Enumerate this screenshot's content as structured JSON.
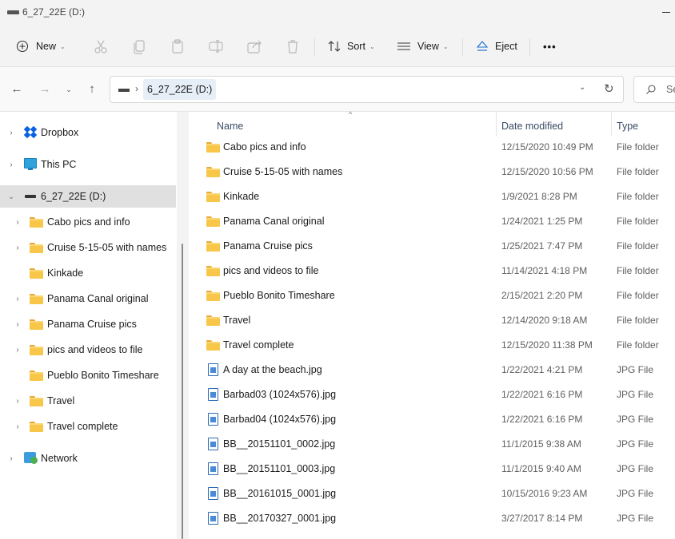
{
  "window": {
    "title": "6_27_22E (D:)"
  },
  "toolbar": {
    "new_label": "New",
    "sort_label": "Sort",
    "view_label": "View",
    "eject_label": "Eject",
    "more_label": "•••"
  },
  "address": {
    "crumb": "6_27_22E (D:)",
    "search_placeholder": "Se"
  },
  "nav": {
    "items": [
      {
        "label": "Dropbox"
      },
      {
        "label": "This PC"
      },
      {
        "label": "6_27_22E (D:)"
      },
      {
        "label": "Cabo pics and info"
      },
      {
        "label": "Cruise 5-15-05 with names"
      },
      {
        "label": "Kinkade"
      },
      {
        "label": "Panama Canal original"
      },
      {
        "label": "Panama Cruise pics"
      },
      {
        "label": "pics and videos to file"
      },
      {
        "label": "Pueblo Bonito Timeshare"
      },
      {
        "label": "Travel"
      },
      {
        "label": "Travel complete"
      },
      {
        "label": "Network"
      }
    ]
  },
  "columns": {
    "name": "Name",
    "date": "Date modified",
    "type": "Type"
  },
  "files": [
    {
      "name": "Cabo pics and info",
      "date": "12/15/2020 10:49 PM",
      "type": "File folder",
      "kind": "folder"
    },
    {
      "name": "Cruise 5-15-05 with names",
      "date": "12/15/2020 10:56 PM",
      "type": "File folder",
      "kind": "folder"
    },
    {
      "name": "Kinkade",
      "date": "1/9/2021 8:28 PM",
      "type": "File folder",
      "kind": "folder"
    },
    {
      "name": "Panama Canal original",
      "date": "1/24/2021 1:25 PM",
      "type": "File folder",
      "kind": "folder"
    },
    {
      "name": "Panama Cruise pics",
      "date": "1/25/2021 7:47 PM",
      "type": "File folder",
      "kind": "folder"
    },
    {
      "name": "pics and videos to file",
      "date": "11/14/2021 4:18 PM",
      "type": "File folder",
      "kind": "folder"
    },
    {
      "name": "Pueblo Bonito Timeshare",
      "date": "2/15/2021 2:20 PM",
      "type": "File folder",
      "kind": "folder"
    },
    {
      "name": "Travel",
      "date": "12/14/2020 9:18 AM",
      "type": "File folder",
      "kind": "folder"
    },
    {
      "name": "Travel complete",
      "date": "12/15/2020 11:38 PM",
      "type": "File folder",
      "kind": "folder"
    },
    {
      "name": "A day at the beach.jpg",
      "date": "1/22/2021 4:21 PM",
      "type": "JPG File",
      "kind": "jpg"
    },
    {
      "name": "Barbad03 (1024x576).jpg",
      "date": "1/22/2021 6:16 PM",
      "type": "JPG File",
      "kind": "jpg"
    },
    {
      "name": "Barbad04 (1024x576).jpg",
      "date": "1/22/2021 6:16 PM",
      "type": "JPG File",
      "kind": "jpg"
    },
    {
      "name": "BB__20151101_0002.jpg",
      "date": "11/1/2015 9:38 AM",
      "type": "JPG File",
      "kind": "jpg"
    },
    {
      "name": "BB__20151101_0003.jpg",
      "date": "11/1/2015 9:40 AM",
      "type": "JPG File",
      "kind": "jpg"
    },
    {
      "name": "BB__20161015_0001.jpg",
      "date": "10/15/2016 9:23 AM",
      "type": "JPG File",
      "kind": "jpg"
    },
    {
      "name": "BB__20170327_0001.jpg",
      "date": "3/27/2017 8:14 PM",
      "type": "JPG File",
      "kind": "jpg"
    }
  ]
}
